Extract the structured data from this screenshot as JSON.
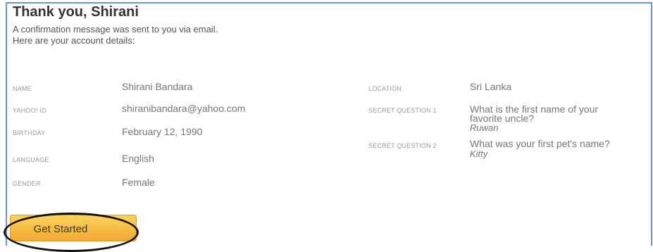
{
  "header": {
    "title": "Thank you, Shirani",
    "intro_line1": "A confirmation message was sent to you via email.",
    "intro_line2": "Here are your account details:"
  },
  "details_left": [
    {
      "label": "NAME",
      "value": "Shirani Bandara"
    },
    {
      "label": "YAHOO! ID",
      "value": "shiranibandara@yahoo.com"
    },
    {
      "label": "BIRTHDAY",
      "value": "February 12, 1990"
    },
    {
      "label": "LANGUAGE",
      "value": "English"
    },
    {
      "label": "GENDER",
      "value": "Female"
    }
  ],
  "details_right": {
    "location": {
      "label": "LOCATION",
      "value": "Sri Lanka"
    },
    "secret_question_1": {
      "label": "SECRET QUESTION 1",
      "question_line1": "What is the first name of your",
      "question_line2": "favorite uncle?",
      "answer": "Ruwan"
    },
    "secret_question_2": {
      "label": "SECRET QUESTION 2",
      "question": "What was your first pet's name?",
      "answer": "Kitty"
    }
  },
  "actions": {
    "get_started_label": "Get Started"
  },
  "colors": {
    "panel_border": "#6d94cf",
    "button_top": "#fbd35e",
    "button_bottom": "#f3a92b",
    "ellipse": "#111111"
  }
}
